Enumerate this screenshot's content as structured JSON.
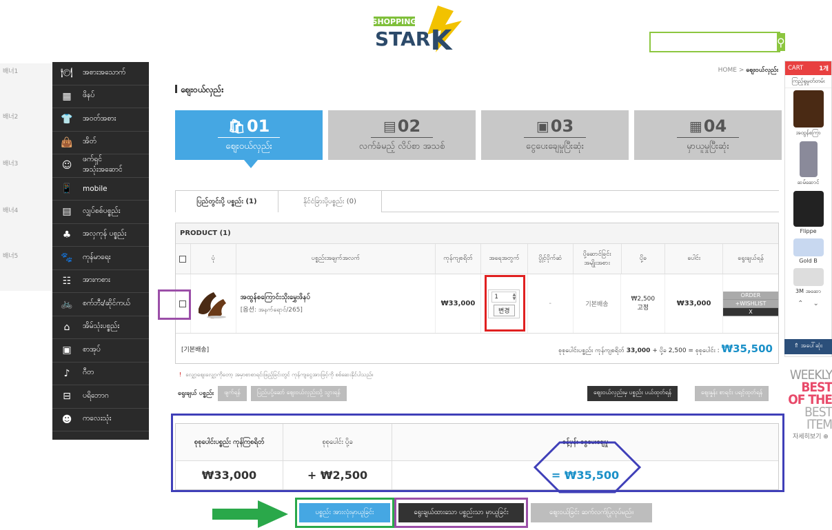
{
  "header": {
    "logo_top": "SHOPPING",
    "logo_bottom": "STAR",
    "logo_k": "K",
    "search_placeholder": ""
  },
  "banners": [
    "배너1",
    "배너2",
    "배너3",
    "배너4",
    "배너5"
  ],
  "categories": [
    {
      "icon": "restaurant-icon",
      "glyph": "🍽",
      "label": "အစားအသောက်"
    },
    {
      "icon": "kitchen-icon",
      "glyph": "▦",
      "label": "ဖိနပ်"
    },
    {
      "icon": "shirt-icon",
      "glyph": "👕",
      "label": "အဝတ်အစား"
    },
    {
      "icon": "bag-icon",
      "glyph": "👜",
      "label": "အိတ်"
    },
    {
      "icon": "cosmetics-icon",
      "glyph": "☺",
      "label": "ဖက်ရှင်\nအသုံးအဆောင်"
    },
    {
      "icon": "mobile-icon",
      "glyph": "📱",
      "label": "mobile"
    },
    {
      "icon": "appliance-icon",
      "glyph": "▤",
      "label": "လျှပ်စစ်ပစ္စည်း"
    },
    {
      "icon": "gift-icon",
      "glyph": "♣",
      "label": "အလှကုန် ပစ္စည်း"
    },
    {
      "icon": "pet-icon",
      "glyph": "🐾",
      "label": "ကုန်မာရေး"
    },
    {
      "icon": "toy-icon",
      "glyph": "☷",
      "label": "အားကစား"
    },
    {
      "icon": "bicycle-icon",
      "glyph": "🚲",
      "label": "စက်ဘီး/ဆိုင်ကယ်"
    },
    {
      "icon": "home-icon",
      "glyph": "⌂",
      "label": "အိမ်သုံးပစ္စည်း"
    },
    {
      "icon": "book-icon",
      "glyph": "▣",
      "label": "စာအုပ်"
    },
    {
      "icon": "guitar-icon",
      "glyph": "♪",
      "label": "ဂီတ"
    },
    {
      "icon": "furniture-icon",
      "glyph": "⊟",
      "label": "ပရိဘောဂ"
    },
    {
      "icon": "baby-icon",
      "glyph": "☻",
      "label": "ကလေးသုံး"
    }
  ],
  "breadcrumb": {
    "home": "HOME",
    "sep": ">",
    "current": "ဈေးဝယ်လှည်း"
  },
  "page_title": "ဈေးဝယ်လှည်း",
  "steps": [
    {
      "num": "01",
      "icon": "basket-icon",
      "glyph": "🛍",
      "label": "ဈေးဝယ်လှည်း",
      "active": true
    },
    {
      "num": "02",
      "icon": "document-icon",
      "glyph": "▤",
      "label": "လက်ခံမည့် လိပ်စာ အသစ်",
      "active": false
    },
    {
      "num": "03",
      "icon": "payment-icon",
      "glyph": "▣",
      "label": "ငွေပေးချေမှုပြီးဆုံး",
      "active": false
    },
    {
      "num": "04",
      "icon": "gift-box-icon",
      "glyph": "▦",
      "label": "မှာယူမှုပြီးဆုံး",
      "active": false
    }
  ],
  "tabs": [
    {
      "label": "ပြည်တွင်းပို့ ပစ္စည်း (1)"
    },
    {
      "label": "နိုင်ငံခြားပို့ပစ္စည်း (0)"
    }
  ],
  "table": {
    "product_header": "PRODUCT (1)",
    "columns": [
      "ပုံ",
      "ပစ္စည်းအချက်အလက်",
      "ကုန်ကျစရိတ်",
      "အရေအတွက်",
      "ပွိုင့်ပိုက်ဆံ",
      "ပို့ဆောင်ခြင်း\nအမျိုးအစား",
      "ပို့ခ",
      "ပေါင်း",
      "ရွေးချယ်ရန်"
    ],
    "row": {
      "name": "အထွန်စကြောင်းသိုးမွှေးဖိနပ်",
      "option": "[옵션: အနက်ရောင်/265]",
      "price": "₩33,000",
      "qty": "1",
      "qty_btn": "변경",
      "points": "-",
      "ship_type": "기본배송",
      "ship_fee": "₩2,500\n고정",
      "total": "₩33,000",
      "actions": [
        "ORDER",
        "+WISHLIST",
        "X"
      ]
    },
    "footer_left": "[기본배송]",
    "footer_text_a": "စုစုပေါင်းပစ္စည်း ကုန်ကျစရိတ်",
    "footer_val_a": "33,000",
    "footer_text_b": "+ ပို့ခ 2,500 = စုစုပေါင်း :",
    "footer_total": "₩35,500"
  },
  "notice": "လျှော့စျေးလျှော့ကိုတော့ အမှာစာစာရင်းဖြည့်ခြင်းတွင် ကုန်ကျငွေအားဖြင့်ကို စစ်ဆေးနိုင်ပါသည်။",
  "select_row": {
    "label": "ရွေးချယ် ပစ္စည်း",
    "delete": "ဖျက်ရန်",
    "move": "ပြည်ပပို့ဆော် ဈေးဝယ်လှည်းသို့ သွားရန်",
    "clear_cart": "ဈေးဝယ်လှည်းမှ ပစ္စည်း ပယ်ထုတ်ရန်",
    "quote": "ဈေးနှုန်း စာရင်း ပရင့်ထုတ်ရန်"
  },
  "summary": {
    "h1": "စုစုပေါင်းပစ္စည်း ကုန်ကြစရိတ်",
    "v1": "₩33,000",
    "h2": "စုစုပေါင်း ပို့ခ",
    "v2": "+ ₩2,500",
    "h3": "ခန့်မှန်း ငွေပေးချေမှု",
    "v3": "= ₩35,500"
  },
  "bottom_buttons": {
    "order_all": "ပစ္စည်း အားလုံးမှာယူခြင်း",
    "order_selected": "ရွေးချယ်ထားသော ပစ္စည်းသာ မှာယူခြင်း",
    "continue": "ဈေးဝယ်ခြင်း ဆက်လက်ပြုလုပ်မည်။"
  },
  "right_sidebar": {
    "cart_label": "CART",
    "cart_count": "1개",
    "title": "ကြည့်ရှုမှုတ်တမ်း",
    "items": [
      {
        "name": "အထွန်စကြာ",
        "icon": "shoe-icon"
      },
      {
        "name": "ဆမ်ဆောင်",
        "icon": "phone-icon"
      },
      {
        "name": "Flippe",
        "icon": "speaker-icon"
      },
      {
        "name": "Gold B",
        "icon": "card-icon"
      },
      {
        "name": "3M အဆော",
        "icon": "mask-icon"
      }
    ],
    "top": "⇑ အပေါ်ဆုံး"
  },
  "weekly": {
    "a": "WEEKLY",
    "b": "BEST OF THE",
    "c": "BEST ITEM",
    "more": "자세히보기 ⊕"
  },
  "colors": {
    "accent": "#45a7e3",
    "dark": "#2a2a2a",
    "green": "#8cc63f",
    "annot_blue": "#3f3fb8",
    "annot_purple": "#9b4fa8",
    "annot_red": "#e02020",
    "annot_green": "#2aa84a"
  }
}
